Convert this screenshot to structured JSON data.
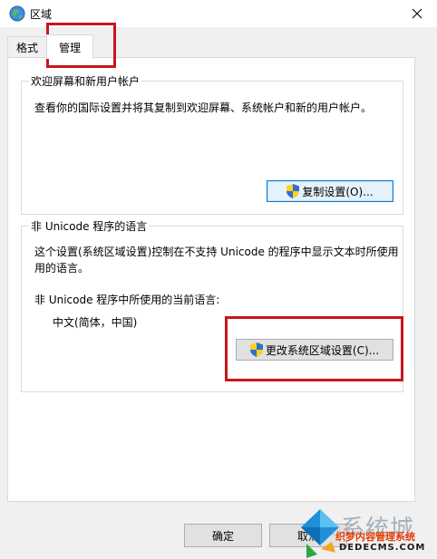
{
  "window": {
    "title": "区域"
  },
  "tabs": [
    {
      "label": "格式",
      "selected": false
    },
    {
      "label": "管理",
      "selected": true
    }
  ],
  "welcome_group": {
    "title": "欢迎屏幕和新用户帐户",
    "description": "查看你的国际设置并将其复制到欢迎屏幕、系统帐户和新的用户帐户。",
    "copy_button": "复制设置(O)..."
  },
  "unicode_group": {
    "title": "非 Unicode 程序的语言",
    "description_line1": "这个设置(系统区域设置)控制在不支持 Unicode 的程序中显示文本时所使用",
    "description_line2": "用的语言。",
    "current_label": "非 Unicode 程序中所使用的当前语言:",
    "current_value": "中文(简体，中国)",
    "change_button": "更改系统区域设置(C)..."
  },
  "footer": {
    "ok_button": "确定",
    "cancel_button": "取消"
  },
  "watermark": {
    "brand": "系统城",
    "line1": "织梦内容管理系统",
    "line2": "DEDECMS.COM",
    "url": "xitongcheng.com"
  },
  "colors": {
    "highlight": "#c8161d",
    "focus_border": "#0078d7"
  }
}
